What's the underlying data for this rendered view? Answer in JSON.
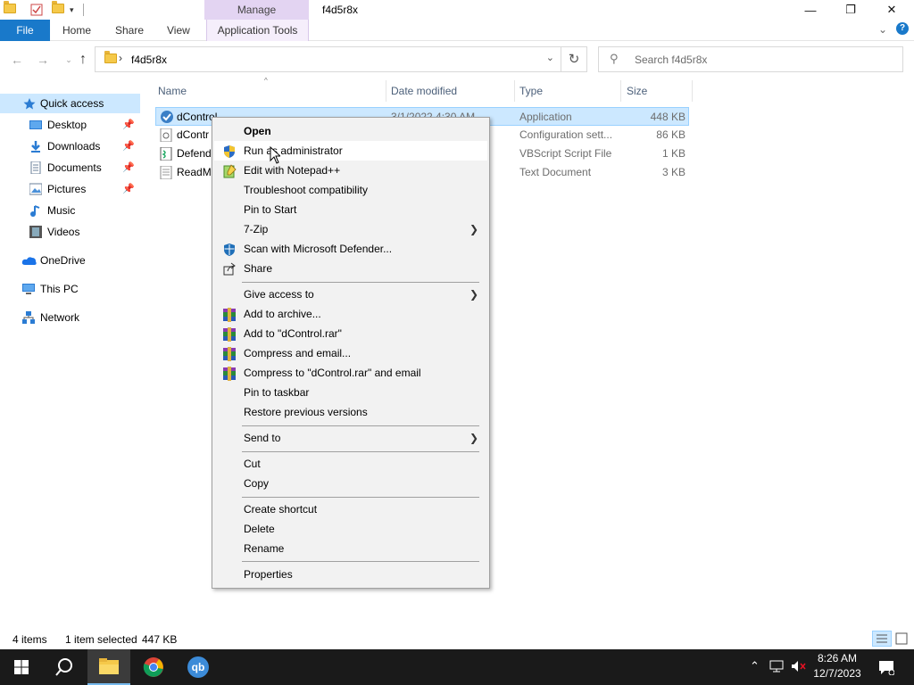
{
  "window": {
    "title": "f4d5r8x",
    "manage_tab": "Manage",
    "minimize": "—",
    "maximize": "❐",
    "close": "✕",
    "help": "?",
    "collapse": "⌄"
  },
  "ribbon": {
    "file": "File",
    "home": "Home",
    "share": "Share",
    "view": "View",
    "application_tools": "Application Tools"
  },
  "address": {
    "path": "f4d5r8x",
    "search_placeholder": "Search f4d5r8x"
  },
  "nav": {
    "quick_access": "Quick access",
    "desktop": "Desktop",
    "downloads": "Downloads",
    "documents": "Documents",
    "pictures": "Pictures",
    "music": "Music",
    "videos": "Videos",
    "onedrive": "OneDrive",
    "this_pc": "This PC",
    "network": "Network"
  },
  "columns": {
    "name": "Name",
    "date_modified": "Date modified",
    "type": "Type",
    "size": "Size"
  },
  "files": [
    {
      "name": "dControl",
      "date": "3/1/2022 4:30 AM",
      "type": "Application",
      "size": "448 KB"
    },
    {
      "name": "dContr",
      "date": "",
      "type": "Configuration sett...",
      "size": "86 KB"
    },
    {
      "name": "Defend",
      "date": "",
      "type": "VBScript Script File",
      "size": "1 KB"
    },
    {
      "name": "ReadMe",
      "date": "",
      "type": "Text Document",
      "size": "3 KB"
    }
  ],
  "context_menu": {
    "open": "Open",
    "run_as_admin": "Run as administrator",
    "edit_notepad": "Edit with Notepad++",
    "troubleshoot": "Troubleshoot compatibility",
    "pin_start": "Pin to Start",
    "seven_zip": "7-Zip",
    "scan_defender": "Scan with Microsoft Defender...",
    "share": "Share",
    "give_access": "Give access to",
    "add_archive": "Add to archive...",
    "add_rar": "Add to \"dControl.rar\"",
    "compress_email": "Compress and email...",
    "compress_rar_email": "Compress to \"dControl.rar\" and email",
    "pin_taskbar": "Pin to taskbar",
    "restore_versions": "Restore previous versions",
    "send_to": "Send to",
    "cut": "Cut",
    "copy": "Copy",
    "create_shortcut": "Create shortcut",
    "delete": "Delete",
    "rename": "Rename",
    "properties": "Properties"
  },
  "status": {
    "items": "4 items",
    "selected": "1 item selected",
    "size": "447 KB"
  },
  "taskbar": {
    "time": "8:26 AM",
    "date": "12/7/2023",
    "qb_label": "qb"
  },
  "colors": {
    "accent": "#1979ca",
    "selection": "#cce8ff",
    "manage_tab": "#e3d4f2",
    "taskbar": "#1a1a1a"
  }
}
